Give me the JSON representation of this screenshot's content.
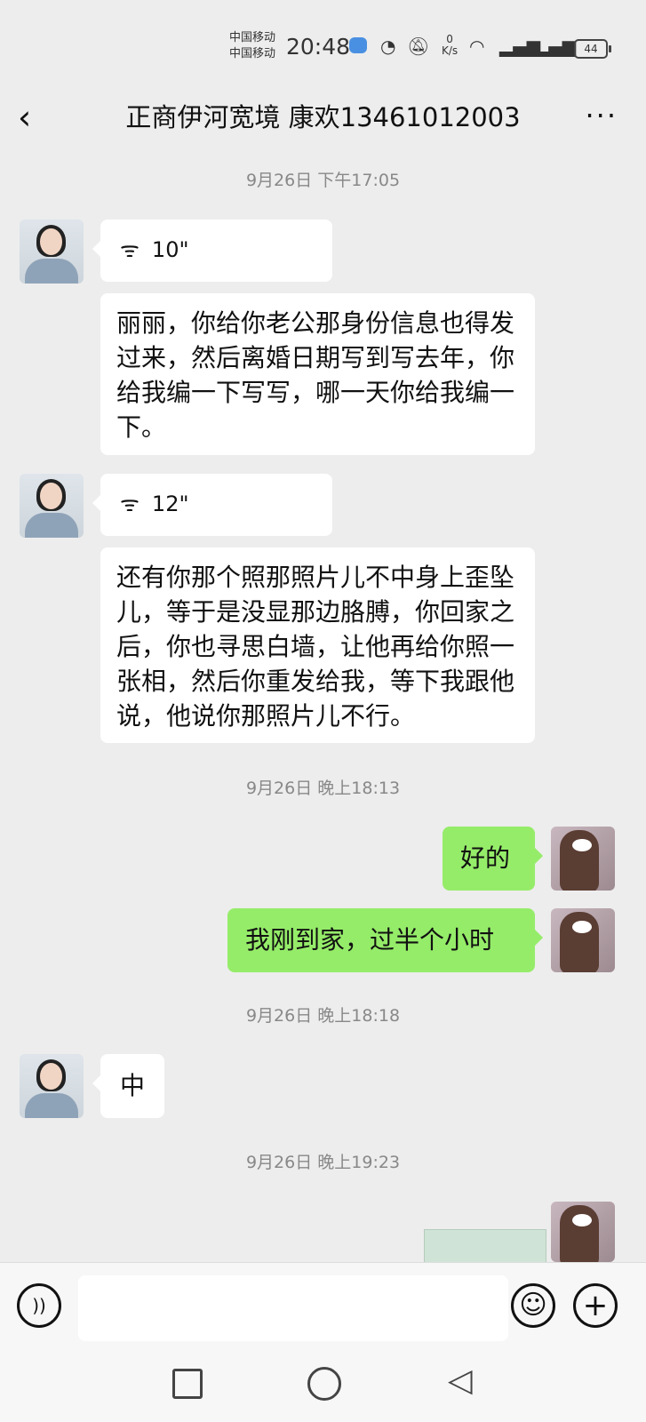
{
  "status_bar": {
    "carrier1": "中国移动",
    "carrier2": "中国移动",
    "time": "20:48",
    "speed_value": "0",
    "speed_unit": "K/s",
    "battery": "44"
  },
  "nav": {
    "back_icon": "‹",
    "title": "正商伊河宽境  康欢13461012003",
    "more_icon": "···"
  },
  "messages": {
    "t1": "9月26日 下午17:05",
    "voice1": "10\"",
    "msg1": "丽丽，你给你老公那身份信息也得发过来，然后离婚日期写到写去年，你给我编一下写写，哪一天你给我编一下。",
    "voice2": "12\"",
    "msg2": "还有你那个照那照片儿不中身上歪坠儿，等于是没显那边胳膊，你回家之后，你也寻思白墙，让他再给你照一张相，然后你重发给我，等下我跟他说，他说你那照片儿不行。",
    "t2": "9月26日 晚上18:13",
    "out1": "好的",
    "out2": "我刚到家，过半个小时",
    "t3": "9月26日 晚上18:18",
    "msg3": "中",
    "t4": "9月26日 晚上19:23"
  },
  "inputbar": {
    "voice_icon": "))",
    "emoji_icon": "☺",
    "plus_icon": "+"
  },
  "icons": {
    "voice_wave": "ᯤ",
    "system_back": "◁"
  },
  "colors": {
    "outgoing_bubble": "#95ec69",
    "incoming_bubble": "#ffffff",
    "background": "#ededed"
  }
}
